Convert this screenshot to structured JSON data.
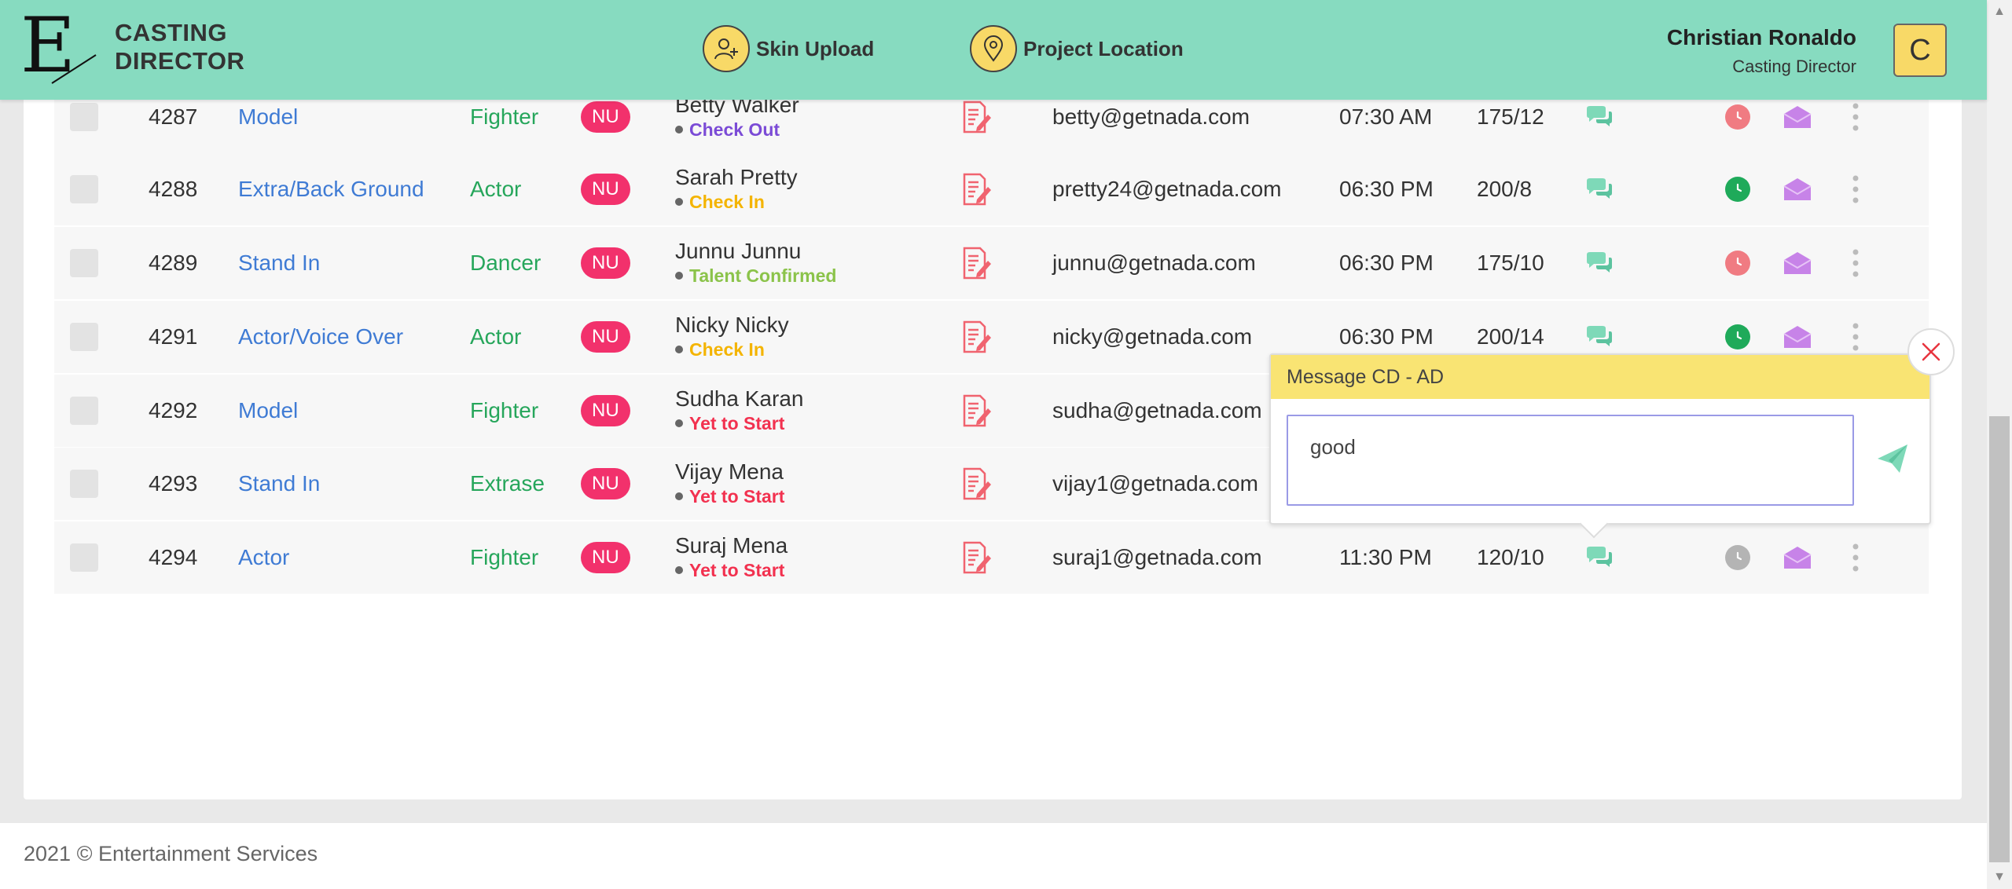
{
  "header": {
    "brand_line1": "CASTING",
    "brand_line2": "DIRECTOR",
    "logo_letter": "E",
    "nav": [
      {
        "label": "Skin Upload",
        "icon": "add-user-icon"
      },
      {
        "label": "Project Location",
        "icon": "location-pin-icon"
      }
    ],
    "user_name": "Christian Ronaldo",
    "user_role": "Casting Director",
    "avatar_initial": "C"
  },
  "colors": {
    "header_bg": "#87dbc0",
    "accent_yellow": "#f8d967",
    "nu_badge": "#f2316c",
    "role_link": "#3f7bd4",
    "talent_green": "#26a65b"
  },
  "rows": [
    {
      "id": "4287",
      "role": "Model",
      "talent": "Fighter",
      "badge": "NU",
      "name": "Betty Walker",
      "status": "Check Out",
      "status_color": "#7b4bd6",
      "email": "betty@getnada.com",
      "time": "07:30 AM",
      "measure": "175/12",
      "clock": "red"
    },
    {
      "id": "4288",
      "role": "Extra/Back Ground",
      "talent": "Actor",
      "badge": "NU",
      "name": "Sarah Pretty",
      "status": "Check In",
      "status_color": "#f4b400",
      "email": "pretty24@getnada.com",
      "time": "06:30 PM",
      "measure": "200/8",
      "clock": "green"
    },
    {
      "id": "4289",
      "role": "Stand In",
      "talent": "Dancer",
      "badge": "NU",
      "name": "Junnu Junnu",
      "status": "Talent Confirmed",
      "status_color": "#8bc34a",
      "email": "junnu@getnada.com",
      "time": "06:30 PM",
      "measure": "175/10",
      "clock": "red"
    },
    {
      "id": "4291",
      "role": "Actor/Voice Over",
      "talent": "Actor",
      "badge": "NU",
      "name": "Nicky Nicky",
      "status": "Check In",
      "status_color": "#f4b400",
      "email": "nicky@getnada.com",
      "time": "06:30 PM",
      "measure": "200/14",
      "clock": "green"
    },
    {
      "id": "4292",
      "role": "Model",
      "talent": "Fighter",
      "badge": "NU",
      "name": "Sudha Karan",
      "status": "Yet to Start",
      "status_color": "#f2314f",
      "email": "sudha@getnada.com",
      "time": "",
      "measure": "",
      "clock": "none"
    },
    {
      "id": "4293",
      "role": "Stand In",
      "talent": "Extrase",
      "badge": "NU",
      "name": "Vijay Mena",
      "status": "Yet to Start",
      "status_color": "#f2314f",
      "email": "vijay1@getnada.com",
      "time": "",
      "measure": "",
      "clock": "none"
    },
    {
      "id": "4294",
      "role": "Actor",
      "talent": "Fighter",
      "badge": "NU",
      "name": "Suraj Mena",
      "status": "Yet to Start",
      "status_color": "#f2314f",
      "email": "suraj1@getnada.com",
      "time": "11:30 PM",
      "measure": "120/10",
      "clock": "grey"
    }
  ],
  "popup": {
    "title": "Message CD - AD",
    "message_value": "good"
  },
  "footer": {
    "text": "2021 © Entertainment Services"
  }
}
